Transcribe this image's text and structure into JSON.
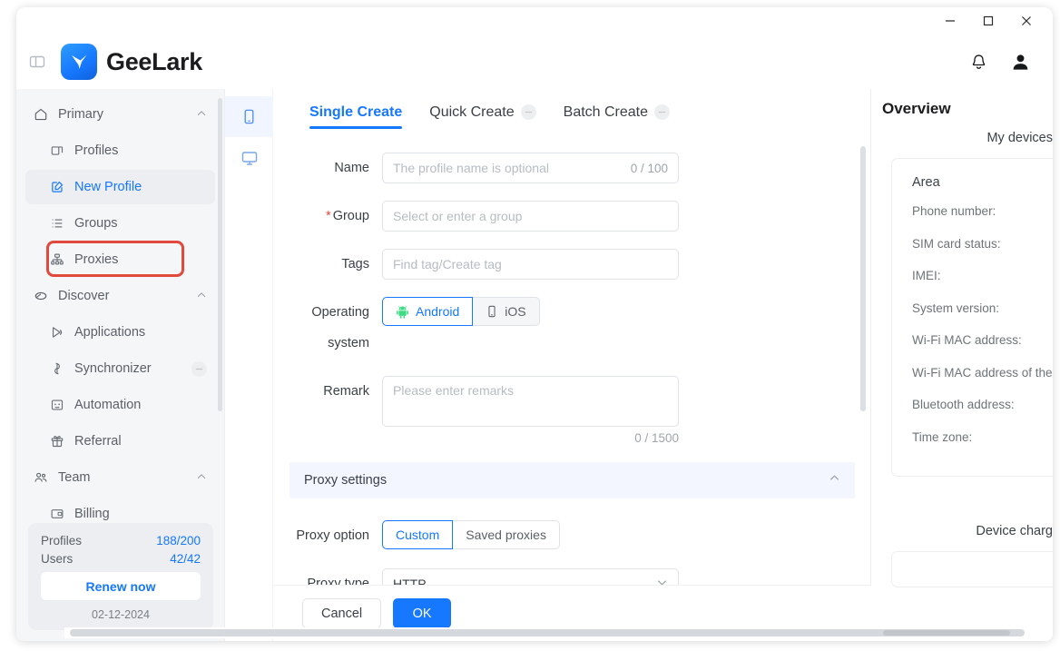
{
  "window": {
    "controls": {
      "minimize": "minimize-button",
      "maximize": "maximize-button",
      "close": "close-button"
    }
  },
  "header": {
    "brand": "GeeLark",
    "panel_toggle_icon": "panel-toggle-icon",
    "notification_icon": "bell-icon",
    "avatar_icon": "user-avatar-icon"
  },
  "sidebar": {
    "groups": [
      {
        "label": "Primary",
        "icon": "home-icon",
        "items": [
          {
            "label": "Profiles",
            "icon": "profiles-icon",
            "active": false,
            "badge": ""
          },
          {
            "label": "New Profile",
            "icon": "edit-square-icon",
            "active": true,
            "badge": ""
          },
          {
            "label": "Groups",
            "icon": "list-icon",
            "active": false,
            "badge": ""
          },
          {
            "label": "Proxies",
            "icon": "network-icon",
            "active": false,
            "badge": ""
          }
        ]
      },
      {
        "label": "Discover",
        "icon": "cloud-icon",
        "items": [
          {
            "label": "Applications",
            "icon": "apps-icon",
            "active": false,
            "badge": ""
          },
          {
            "label": "Synchronizer",
            "icon": "sync-icon",
            "active": false,
            "badge": "•"
          },
          {
            "label": "Automation",
            "icon": "automation-icon",
            "active": false,
            "badge": ""
          },
          {
            "label": "Referral",
            "icon": "gift-icon",
            "active": false,
            "badge": ""
          }
        ]
      },
      {
        "label": "Team",
        "icon": "team-icon",
        "items": [
          {
            "label": "Billing",
            "icon": "billing-icon",
            "active": false,
            "badge": ""
          }
        ]
      }
    ],
    "quota": {
      "profiles_label": "Profiles",
      "profiles_value": "188/200",
      "users_label": "Users",
      "users_value": "42/42",
      "renew_label": "Renew now",
      "date": "02-12-2024"
    }
  },
  "rail": {
    "items": [
      {
        "icon": "phone-icon",
        "active": true
      },
      {
        "icon": "monitor-icon",
        "active": false
      }
    ]
  },
  "tabs": [
    {
      "label": "Single Create",
      "active": true,
      "badge": ""
    },
    {
      "label": "Quick Create",
      "active": false,
      "badge": "•"
    },
    {
      "label": "Batch Create",
      "active": false,
      "badge": "•"
    }
  ],
  "form": {
    "name": {
      "label": "Name",
      "placeholder": "The profile name is optional",
      "value": "",
      "counter": "0 / 100"
    },
    "group": {
      "label": "Group",
      "required": true,
      "placeholder": "Select or enter a group",
      "value": ""
    },
    "tags": {
      "label": "Tags",
      "placeholder": "Find tag/Create tag",
      "value": ""
    },
    "os": {
      "label": "Operating system",
      "options": [
        {
          "label": "Android",
          "icon": "android-icon",
          "selected": true
        },
        {
          "label": "iOS",
          "icon": "apple-phone-icon",
          "selected": false
        }
      ]
    },
    "remark": {
      "label": "Remark",
      "placeholder": "Please enter remarks",
      "value": "",
      "counter": "0 / 1500"
    }
  },
  "proxy": {
    "section_title": "Proxy settings",
    "collapse_icon": "chevron-up-icon",
    "option": {
      "label": "Proxy option",
      "choices": [
        {
          "label": "Custom",
          "selected": true
        },
        {
          "label": "Saved proxies",
          "selected": false
        }
      ]
    },
    "type": {
      "label": "Proxy type",
      "value": "HTTP",
      "chevron": "chevron-down-icon"
    }
  },
  "footer": {
    "cancel_label": "Cancel",
    "ok_label": "OK"
  },
  "overview": {
    "title": "Overview",
    "subtitle": "My devices",
    "area_label": "Area",
    "fields": [
      "Phone number:",
      "SIM card status:",
      "IMEI:",
      "System version:",
      "Wi-Fi MAC address:",
      "Wi-Fi MAC address of the phone:",
      "Bluetooth address:",
      "Time zone:"
    ],
    "charge_label": "Device charg"
  },
  "colors": {
    "accent": "#1677ff",
    "highlight": "#e0493c",
    "sidebar_bg": "#f5f6f8",
    "section_bg": "#f3f6fe"
  }
}
